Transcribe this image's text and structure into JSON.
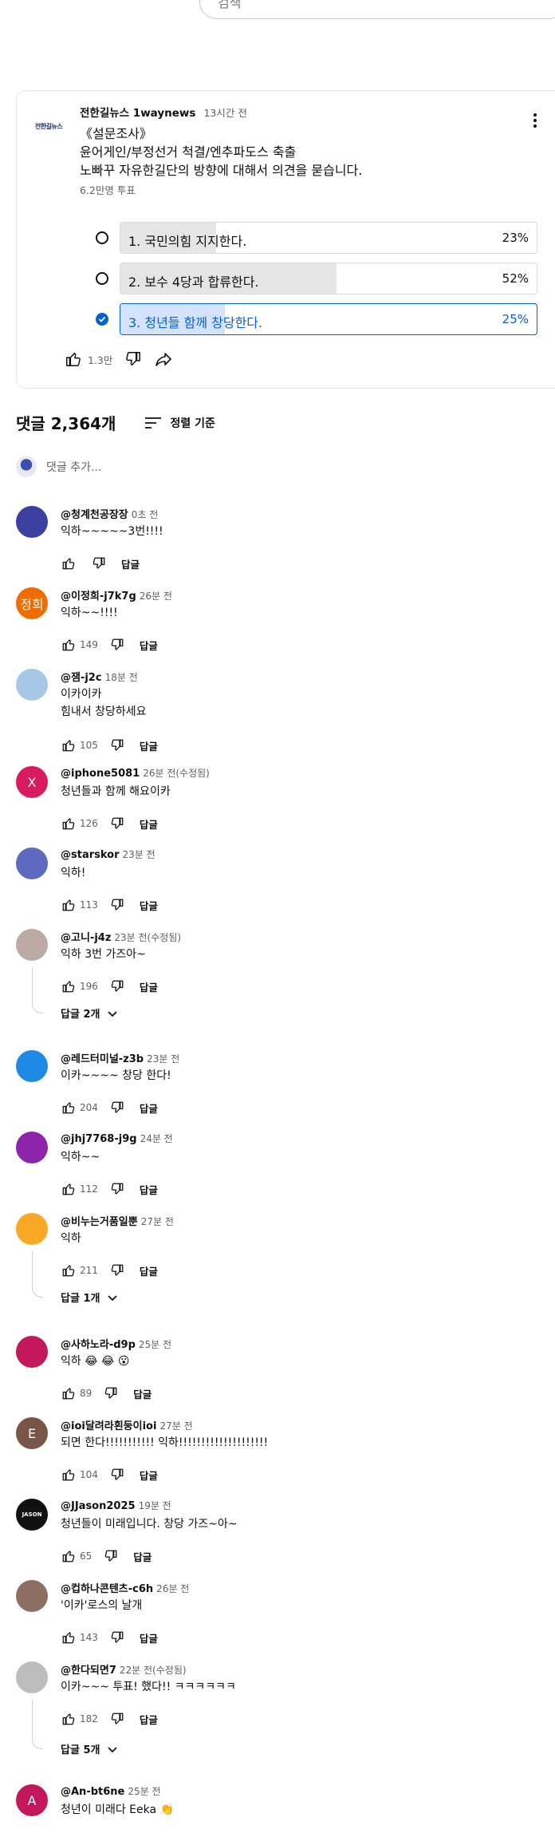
{
  "search": {
    "placeholder": "검색"
  },
  "post": {
    "channel": "전한길뉴스 1waynews",
    "time": "13시간 전",
    "avatar_text": "전한길뉴스",
    "lines": [
      "《설문조사》",
      "윤어게인/부정선거 척결/엔추파도스 축출",
      "노빠꾸 자유한길단의 방향에 대해서 의견을 묻습니다."
    ],
    "votes": "6.2만명 투표",
    "like_count": "1.3만",
    "poll": [
      {
        "label": "1. 국민의힘 지지한다.",
        "percent": "23%",
        "fill": 0.23,
        "selected": false
      },
      {
        "label": "2. 보수 4당과 합류한다.",
        "percent": "52%",
        "fill": 0.52,
        "selected": false
      },
      {
        "label": "3. 청년들 함께 창당한다.",
        "percent": "25%",
        "fill": 0.25,
        "selected": true
      }
    ]
  },
  "comments_header": {
    "count": "댓글 2,364개",
    "sort": "정렬 기준"
  },
  "add_comment": {
    "placeholder": "댓글 추가..."
  },
  "reply_label": "답글",
  "comments": [
    {
      "author": "@청계천공장장",
      "time": "0초 전",
      "text": "익하~~~~~3번!!!!",
      "likes": "",
      "avatar": "",
      "avatar_color": "#3b3f9e"
    },
    {
      "author": "@이정희-j7k7g",
      "time": "26분 전",
      "text": "익하~~!!!!",
      "likes": "149",
      "avatar": "정희",
      "avatar_color": "#ef6c00"
    },
    {
      "author": "@잼-j2c",
      "time": "18분 전",
      "text": "이카이카\n힘내서 창당하세요",
      "likes": "105",
      "avatar": "",
      "avatar_color": "#a7c7e7"
    },
    {
      "author": "@iphone5081",
      "time": "26분 전(수정됨)",
      "text": "청년들과 함께 해요이카",
      "likes": "126",
      "avatar": "X",
      "avatar_color": "#d81b60"
    },
    {
      "author": "@starskor",
      "time": "23분 전",
      "text": "익하!",
      "likes": "113",
      "avatar": "",
      "avatar_color": "#5c6bc0"
    },
    {
      "author": "@고니-j4z",
      "time": "23분 전(수정됨)",
      "text": "익하 3번 가즈아~",
      "likes": "196",
      "avatar": "",
      "avatar_color": "#bcaaa4"
    },
    {
      "author": "@레드터미널-z3b",
      "time": "23분 전",
      "text": "이카~~~~ 창당 한다!",
      "likes": "204",
      "avatar": "",
      "avatar_color": "#1e88e5"
    },
    {
      "author": "@jhj7768-j9g",
      "time": "24분 전",
      "text": "익하~~",
      "likes": "112",
      "avatar": "",
      "avatar_color": "#8e24aa"
    },
    {
      "author": "@비누는거품일뿐",
      "time": "27분 전",
      "text": "익하",
      "likes": "211",
      "avatar": "",
      "avatar_color": "#f9a825"
    },
    {
      "author": "@사하노라-d9p",
      "time": "25분 전",
      "text": "익하 😂 😂 😮",
      "likes": "89",
      "avatar": "",
      "avatar_color": "#c2185b"
    },
    {
      "author": "@ioi달려라횐둥이ioi",
      "time": "27분 전",
      "text": "되면 한다!!!!!!!!!!! 익하!!!!!!!!!!!!!!!!!!!!",
      "likes": "104",
      "avatar": "E",
      "avatar_color": "#795548"
    },
    {
      "author": "@JJason2025",
      "time": "19분 전",
      "text": "청년들이 미래입니다. 창당 가즈~아~",
      "likes": "65",
      "avatar": "JASON",
      "avatar_color": "#111111"
    },
    {
      "author": "@컵하나콘텐츠-c6h",
      "time": "26분 전",
      "text": "'이카'로스의 날개",
      "likes": "143",
      "avatar": "",
      "avatar_color": "#8d6e63"
    },
    {
      "author": "@한다되면7",
      "time": "22분 전(수정됨)",
      "text": "이카~~~ 투표! 했다!! ㅋㅋㅋㅋㅋㅋ",
      "likes": "182",
      "avatar": "",
      "avatar_color": "#bdbdbd"
    },
    {
      "author": "@An-bt6ne",
      "time": "25분 전",
      "text": "청년이 미래다 Eeka 👏",
      "likes": "",
      "avatar": "A",
      "avatar_color": "#c2185b"
    }
  ],
  "replies": [
    {
      "label": "답글 2개"
    },
    {
      "label": "답글 1개"
    },
    {
      "label": "답글 5개"
    }
  ]
}
